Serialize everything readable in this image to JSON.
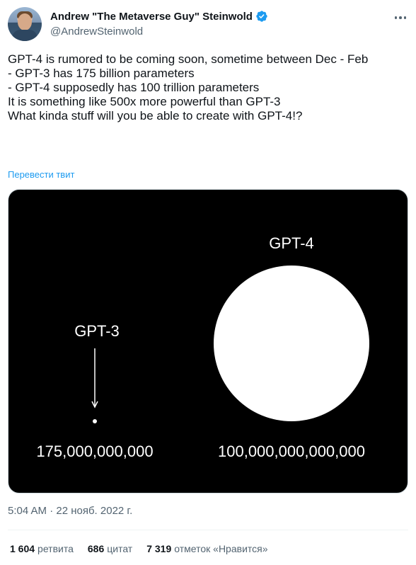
{
  "author": {
    "name": "Andrew \"The Metaverse Guy\" Steinwold",
    "handle": "@AndrewSteinwold",
    "verified_color": "#1d9bf0"
  },
  "tweet": {
    "lines": [
      "GPT-4 is rumored to be coming soon, sometime between Dec - Feb",
      "",
      "- GPT-3 has 175 billion parameters",
      "- GPT-4 supposedly has 100 trillion parameters",
      "",
      "It is something like 500x more powerful than GPT-3",
      "",
      "What kinda stuff will you be able to create with GPT-4!?"
    ],
    "translate_label": "Перевести твит"
  },
  "media": {
    "left_label": "GPT-3",
    "left_value": "175,000,000,000",
    "right_label": "GPT-4",
    "right_value": "100,000,000,000,000",
    "background": "#000000",
    "foreground": "#ffffff"
  },
  "meta": {
    "timestamp": "5:04 AM · 22 нояб. 2022 г."
  },
  "stats": [
    {
      "num": "1 604",
      "label": "ретвита"
    },
    {
      "num": "686",
      "label": "цитат"
    },
    {
      "num": "7 319",
      "label": "отметок «Нравится»"
    }
  ]
}
